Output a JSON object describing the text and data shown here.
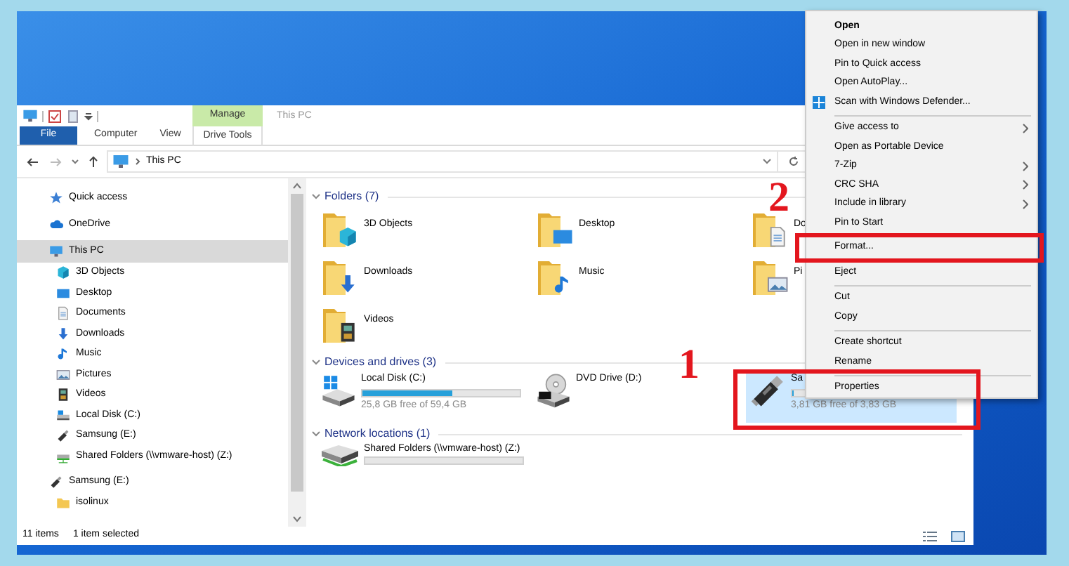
{
  "title_bar": {
    "contextual_tab": "Manage",
    "title": "This PC"
  },
  "ribbon_tabs": [
    {
      "label": "File",
      "kind": "file"
    },
    {
      "label": "Computer",
      "kind": "tab"
    },
    {
      "label": "View",
      "kind": "tab"
    },
    {
      "label": "Drive Tools",
      "kind": "contextual"
    }
  ],
  "address_bar": {
    "path": "This PC"
  },
  "navigation_pane": {
    "items": [
      {
        "label": "Quick access",
        "kind": "star",
        "selected": false
      },
      {
        "label": "OneDrive",
        "kind": "cloud",
        "selected": false
      },
      {
        "label": "This PC",
        "kind": "pc",
        "selected": true,
        "children": [
          {
            "label": "3D Objects",
            "kind": "objects3d",
            "selected": false
          },
          {
            "label": "Desktop",
            "kind": "desktop",
            "selected": false
          },
          {
            "label": "Documents",
            "kind": "documents",
            "selected": false
          },
          {
            "label": "Downloads",
            "kind": "downloads",
            "selected": false
          },
          {
            "label": "Music",
            "kind": "music",
            "selected": false
          },
          {
            "label": "Pictures",
            "kind": "pictures",
            "selected": false
          },
          {
            "label": "Videos",
            "kind": "videos",
            "selected": false
          },
          {
            "label": "Local Disk (C:)",
            "kind": "hdd",
            "selected": false
          },
          {
            "label": "Samsung (E:)",
            "kind": "usb",
            "selected": false
          },
          {
            "label": "Shared Folders (\\\\vmware-host) (Z:)",
            "kind": "network",
            "selected": false
          }
        ]
      },
      {
        "label": "Samsung (E:)",
        "kind": "usb",
        "selected": false,
        "children": [
          {
            "label": "isolinux",
            "kind": "folder",
            "selected": false
          }
        ]
      }
    ]
  },
  "content": {
    "groups": [
      {
        "title": "Folders (7)",
        "expanded": true,
        "items": [
          {
            "label": "3D Objects",
            "kind": "objects3d",
            "selected": false
          },
          {
            "label": "Desktop",
            "kind": "desktop",
            "selected": false
          },
          {
            "label": "Do",
            "kind": "documents",
            "selected": false
          },
          {
            "label": "Downloads",
            "kind": "downloads",
            "selected": false
          },
          {
            "label": "Music",
            "kind": "music",
            "selected": false
          },
          {
            "label": "Pi",
            "kind": "pictures",
            "selected": false
          },
          {
            "label": "Videos",
            "kind": "videos",
            "selected": false
          }
        ]
      },
      {
        "title": "Devices and drives (3)",
        "expanded": true,
        "items": [
          {
            "label": "Local Disk (C:)",
            "kind": "hdd",
            "selected": false,
            "level": 0.57,
            "reading": "25,8 GB free of 59,4 GB"
          },
          {
            "label": "DVD Drive (D:)",
            "kind": "dvd",
            "selected": false
          },
          {
            "label": "Sa",
            "kind": "usb",
            "selected": true,
            "level": 0.01,
            "reading": "3,81 GB free of 3,83 GB",
            "callout": "1"
          }
        ]
      },
      {
        "title": "Network locations (1)",
        "expanded": true,
        "items": [
          {
            "label": "Shared Folders (\\\\vmware-host) (Z:)",
            "kind": "network",
            "selected": false,
            "level": 0
          }
        ]
      }
    ]
  },
  "status_bar": {
    "item_count": "11 items",
    "selection": "1 item selected"
  },
  "context_menu": {
    "items": [
      {
        "kind": "item",
        "label": "Open",
        "default": true,
        "submenu": false,
        "has_icon": false
      },
      {
        "kind": "item",
        "label": "Open in new window",
        "default": false,
        "submenu": false,
        "has_icon": false
      },
      {
        "kind": "item",
        "label": "Pin to Quick access",
        "default": false,
        "submenu": false,
        "has_icon": false
      },
      {
        "kind": "item",
        "label": "Open AutoPlay...",
        "default": false,
        "submenu": false,
        "has_icon": false
      },
      {
        "kind": "item",
        "label": "Scan with Windows Defender...",
        "default": false,
        "submenu": false,
        "has_icon": true
      },
      {
        "kind": "separator"
      },
      {
        "kind": "item",
        "label": "Give access to",
        "default": false,
        "submenu": true,
        "has_icon": false
      },
      {
        "kind": "item",
        "label": "Open as Portable Device",
        "default": false,
        "submenu": false,
        "has_icon": false
      },
      {
        "kind": "item",
        "label": "7-Zip",
        "default": false,
        "submenu": true,
        "has_icon": false
      },
      {
        "kind": "item",
        "label": "CRC SHA",
        "default": false,
        "submenu": true,
        "has_icon": false
      },
      {
        "kind": "item",
        "label": "Include in library",
        "default": false,
        "submenu": true,
        "has_icon": false
      },
      {
        "kind": "item",
        "label": "Pin to Start",
        "default": false,
        "submenu": false,
        "has_icon": false
      },
      {
        "kind": "item",
        "label": "Format...",
        "default": false,
        "submenu": false,
        "has_icon": false,
        "callout": "2"
      },
      {
        "kind": "item",
        "label": "Eject",
        "default": false,
        "submenu": false,
        "has_icon": false
      },
      {
        "kind": "separator"
      },
      {
        "kind": "item",
        "label": "Cut",
        "default": false,
        "submenu": false,
        "has_icon": false
      },
      {
        "kind": "item",
        "label": "Copy",
        "default": false,
        "submenu": false,
        "has_icon": false
      },
      {
        "kind": "separator"
      },
      {
        "kind": "item",
        "label": "Create shortcut",
        "default": false,
        "submenu": false,
        "has_icon": false
      },
      {
        "kind": "item",
        "label": "Rename",
        "default": false,
        "submenu": false,
        "has_icon": false
      },
      {
        "kind": "separator"
      },
      {
        "kind": "item",
        "label": "Properties",
        "default": false,
        "submenu": false,
        "has_icon": false
      }
    ]
  }
}
